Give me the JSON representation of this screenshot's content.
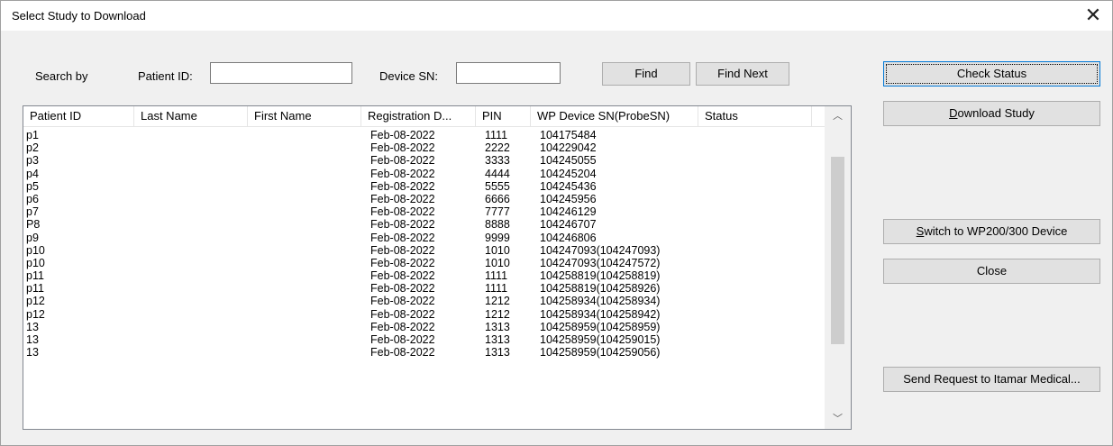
{
  "window": {
    "title": "Select Study to Download"
  },
  "search": {
    "search_by_label": "Search by",
    "patient_id_label": "Patient ID:",
    "patient_id_value": "",
    "device_sn_label": "Device SN:",
    "device_sn_value": "",
    "find_label": "Find",
    "find_next_label": "Find Next"
  },
  "buttons": {
    "check_status": "Check Status",
    "download_study_first": "D",
    "download_study_rest": "ownload Study",
    "switch_first": "S",
    "switch_rest": "witch to WP200/300 Device",
    "close": "Close",
    "send_request": "Send Request to Itamar Medical..."
  },
  "table": {
    "columns": [
      "Patient ID",
      "Last Name",
      "First Name",
      "Registration D...",
      "PIN",
      "WP Device SN(ProbeSN)",
      "Status"
    ],
    "rows": [
      {
        "patient_id": "p1",
        "last_name": "",
        "first_name": "",
        "registration_date": "Feb-08-2022",
        "pin": "1111",
        "device_sn": "104175484",
        "status": ""
      },
      {
        "patient_id": "p2",
        "last_name": "",
        "first_name": "",
        "registration_date": "Feb-08-2022",
        "pin": "2222",
        "device_sn": "104229042",
        "status": ""
      },
      {
        "patient_id": "p3",
        "last_name": "",
        "first_name": "",
        "registration_date": "Feb-08-2022",
        "pin": "3333",
        "device_sn": "104245055",
        "status": ""
      },
      {
        "patient_id": "p4",
        "last_name": "",
        "first_name": "",
        "registration_date": "Feb-08-2022",
        "pin": "4444",
        "device_sn": "104245204",
        "status": ""
      },
      {
        "patient_id": "p5",
        "last_name": "",
        "first_name": "",
        "registration_date": "Feb-08-2022",
        "pin": "5555",
        "device_sn": "104245436",
        "status": ""
      },
      {
        "patient_id": "p6",
        "last_name": "",
        "first_name": "",
        "registration_date": "Feb-08-2022",
        "pin": "6666",
        "device_sn": "104245956",
        "status": ""
      },
      {
        "patient_id": "p7",
        "last_name": "",
        "first_name": "",
        "registration_date": "Feb-08-2022",
        "pin": "7777",
        "device_sn": "104246129",
        "status": ""
      },
      {
        "patient_id": "P8",
        "last_name": "",
        "first_name": "",
        "registration_date": "Feb-08-2022",
        "pin": "8888",
        "device_sn": "104246707",
        "status": ""
      },
      {
        "patient_id": "p9",
        "last_name": "",
        "first_name": "",
        "registration_date": "Feb-08-2022",
        "pin": "9999",
        "device_sn": "104246806",
        "status": ""
      },
      {
        "patient_id": "p10",
        "last_name": "",
        "first_name": "",
        "registration_date": "Feb-08-2022",
        "pin": "1010",
        "device_sn": "104247093(104247093)",
        "status": ""
      },
      {
        "patient_id": "p10",
        "last_name": "",
        "first_name": "",
        "registration_date": "Feb-08-2022",
        "pin": "1010",
        "device_sn": "104247093(104247572)",
        "status": ""
      },
      {
        "patient_id": "p11",
        "last_name": "",
        "first_name": "",
        "registration_date": "Feb-08-2022",
        "pin": "1111",
        "device_sn": "104258819(104258819)",
        "status": ""
      },
      {
        "patient_id": "p11",
        "last_name": "",
        "first_name": "",
        "registration_date": "Feb-08-2022",
        "pin": "1111",
        "device_sn": "104258819(104258926)",
        "status": ""
      },
      {
        "patient_id": "p12",
        "last_name": "",
        "first_name": "",
        "registration_date": "Feb-08-2022",
        "pin": "1212",
        "device_sn": "104258934(104258934)",
        "status": ""
      },
      {
        "patient_id": "p12",
        "last_name": "",
        "first_name": "",
        "registration_date": "Feb-08-2022",
        "pin": "1212",
        "device_sn": "104258934(104258942)",
        "status": ""
      },
      {
        "patient_id": "13",
        "last_name": "",
        "first_name": "",
        "registration_date": "Feb-08-2022",
        "pin": "1313",
        "device_sn": "104258959(104258959)",
        "status": ""
      },
      {
        "patient_id": "13",
        "last_name": "",
        "first_name": "",
        "registration_date": "Feb-08-2022",
        "pin": "1313",
        "device_sn": "104258959(104259015)",
        "status": ""
      },
      {
        "patient_id": "13",
        "last_name": "",
        "first_name": "",
        "registration_date": "Feb-08-2022",
        "pin": "1313",
        "device_sn": "104258959(104259056)",
        "status": ""
      }
    ]
  },
  "icons": {
    "close": "close-icon",
    "scroll_up": "chevron-up-icon",
    "scroll_down": "chevron-down-icon"
  }
}
